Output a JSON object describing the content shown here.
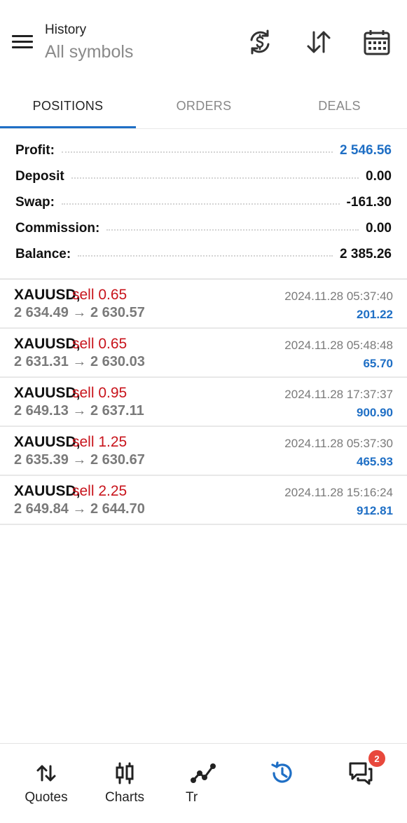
{
  "header": {
    "title": "History",
    "subtitle": "All symbols",
    "icons": [
      "currency-exchange-icon",
      "sort-icon",
      "calendar-icon"
    ]
  },
  "tabs": [
    {
      "label": "POSITIONS",
      "active": true
    },
    {
      "label": "ORDERS",
      "active": false
    },
    {
      "label": "DEALS",
      "active": false
    }
  ],
  "summary": [
    {
      "label": "Profit:",
      "value": "2 546.56",
      "highlight": true
    },
    {
      "label": "Deposit",
      "value": "0.00",
      "highlight": false
    },
    {
      "label": "Swap:",
      "value": "-161.30",
      "highlight": false
    },
    {
      "label": "Commission:",
      "value": "0.00",
      "highlight": false
    },
    {
      "label": "Balance:",
      "value": "2 385.26",
      "highlight": false
    }
  ],
  "deals": [
    {
      "symbol": "XAUUSD,",
      "side": "sell 0.65",
      "prices": "2 634.49 → 2 630.57",
      "time": "2024.11.28 05:37:40",
      "profit": "201.22"
    },
    {
      "symbol": "XAUUSD,",
      "side": "sell 0.65",
      "prices": "2 631.31 → 2 630.03",
      "time": "2024.11.28 05:48:48",
      "profit": "65.70"
    },
    {
      "symbol": "XAUUSD,",
      "side": "sell 0.95",
      "prices": "2 649.13 → 2 637.11",
      "time": "2024.11.28 17:37:37",
      "profit": "900.90"
    },
    {
      "symbol": "XAUUSD,",
      "side": "sell 1.25",
      "prices": "2 635.39 → 2 630.67",
      "time": "2024.11.28 05:37:30",
      "profit": "465.93"
    },
    {
      "symbol": "XAUUSD,",
      "side": "sell 2.25",
      "prices": "2 649.84 → 2 644.70",
      "time": "2024.11.28 15:16:24",
      "profit": "912.81"
    }
  ],
  "bottom_nav": [
    {
      "label": "Quotes",
      "icon": "quotes-arrows-icon",
      "active": false
    },
    {
      "label": "Charts",
      "icon": "candlestick-chart-icon",
      "active": false
    },
    {
      "label": "Tr",
      "icon": "trade-line-icon",
      "active": false
    },
    {
      "label": "",
      "icon": "history-clock-icon",
      "active": true
    },
    {
      "label": "",
      "icon": "messages-icon",
      "active": false,
      "badge": "2"
    }
  ],
  "colors": {
    "accent": "#1f6fc5",
    "sell": "#c8141c",
    "muted": "#7a7a7a",
    "badge": "#e8483c"
  }
}
